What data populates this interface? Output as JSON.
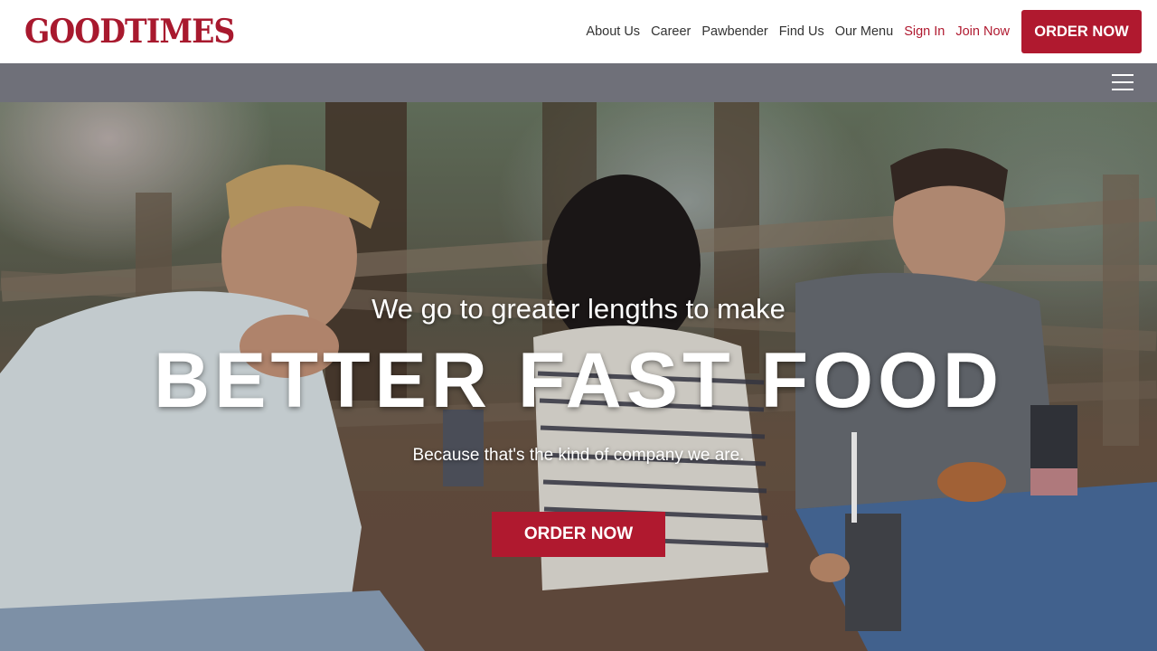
{
  "brand": {
    "name": "GOODTIMES",
    "accent_color": "#b0192f"
  },
  "nav": {
    "items": [
      {
        "label": "About Us"
      },
      {
        "label": "Career"
      },
      {
        "label": "Pawbender"
      },
      {
        "label": "Find Us"
      },
      {
        "label": "Our Menu"
      },
      {
        "label": "Sign In"
      },
      {
        "label": "Join Now"
      }
    ],
    "order_label": "ORDER NOW"
  },
  "subbar": {
    "menu_icon": "hamburger-menu-icon"
  },
  "hero": {
    "tagline": "We go to greater lengths to make",
    "headline": "BETTER FAST FOOD",
    "subline": "Because that's the kind of company we are.",
    "cta_label": "ORDER NOW",
    "image_description_icon": "people-eating-outdoors-photo"
  }
}
